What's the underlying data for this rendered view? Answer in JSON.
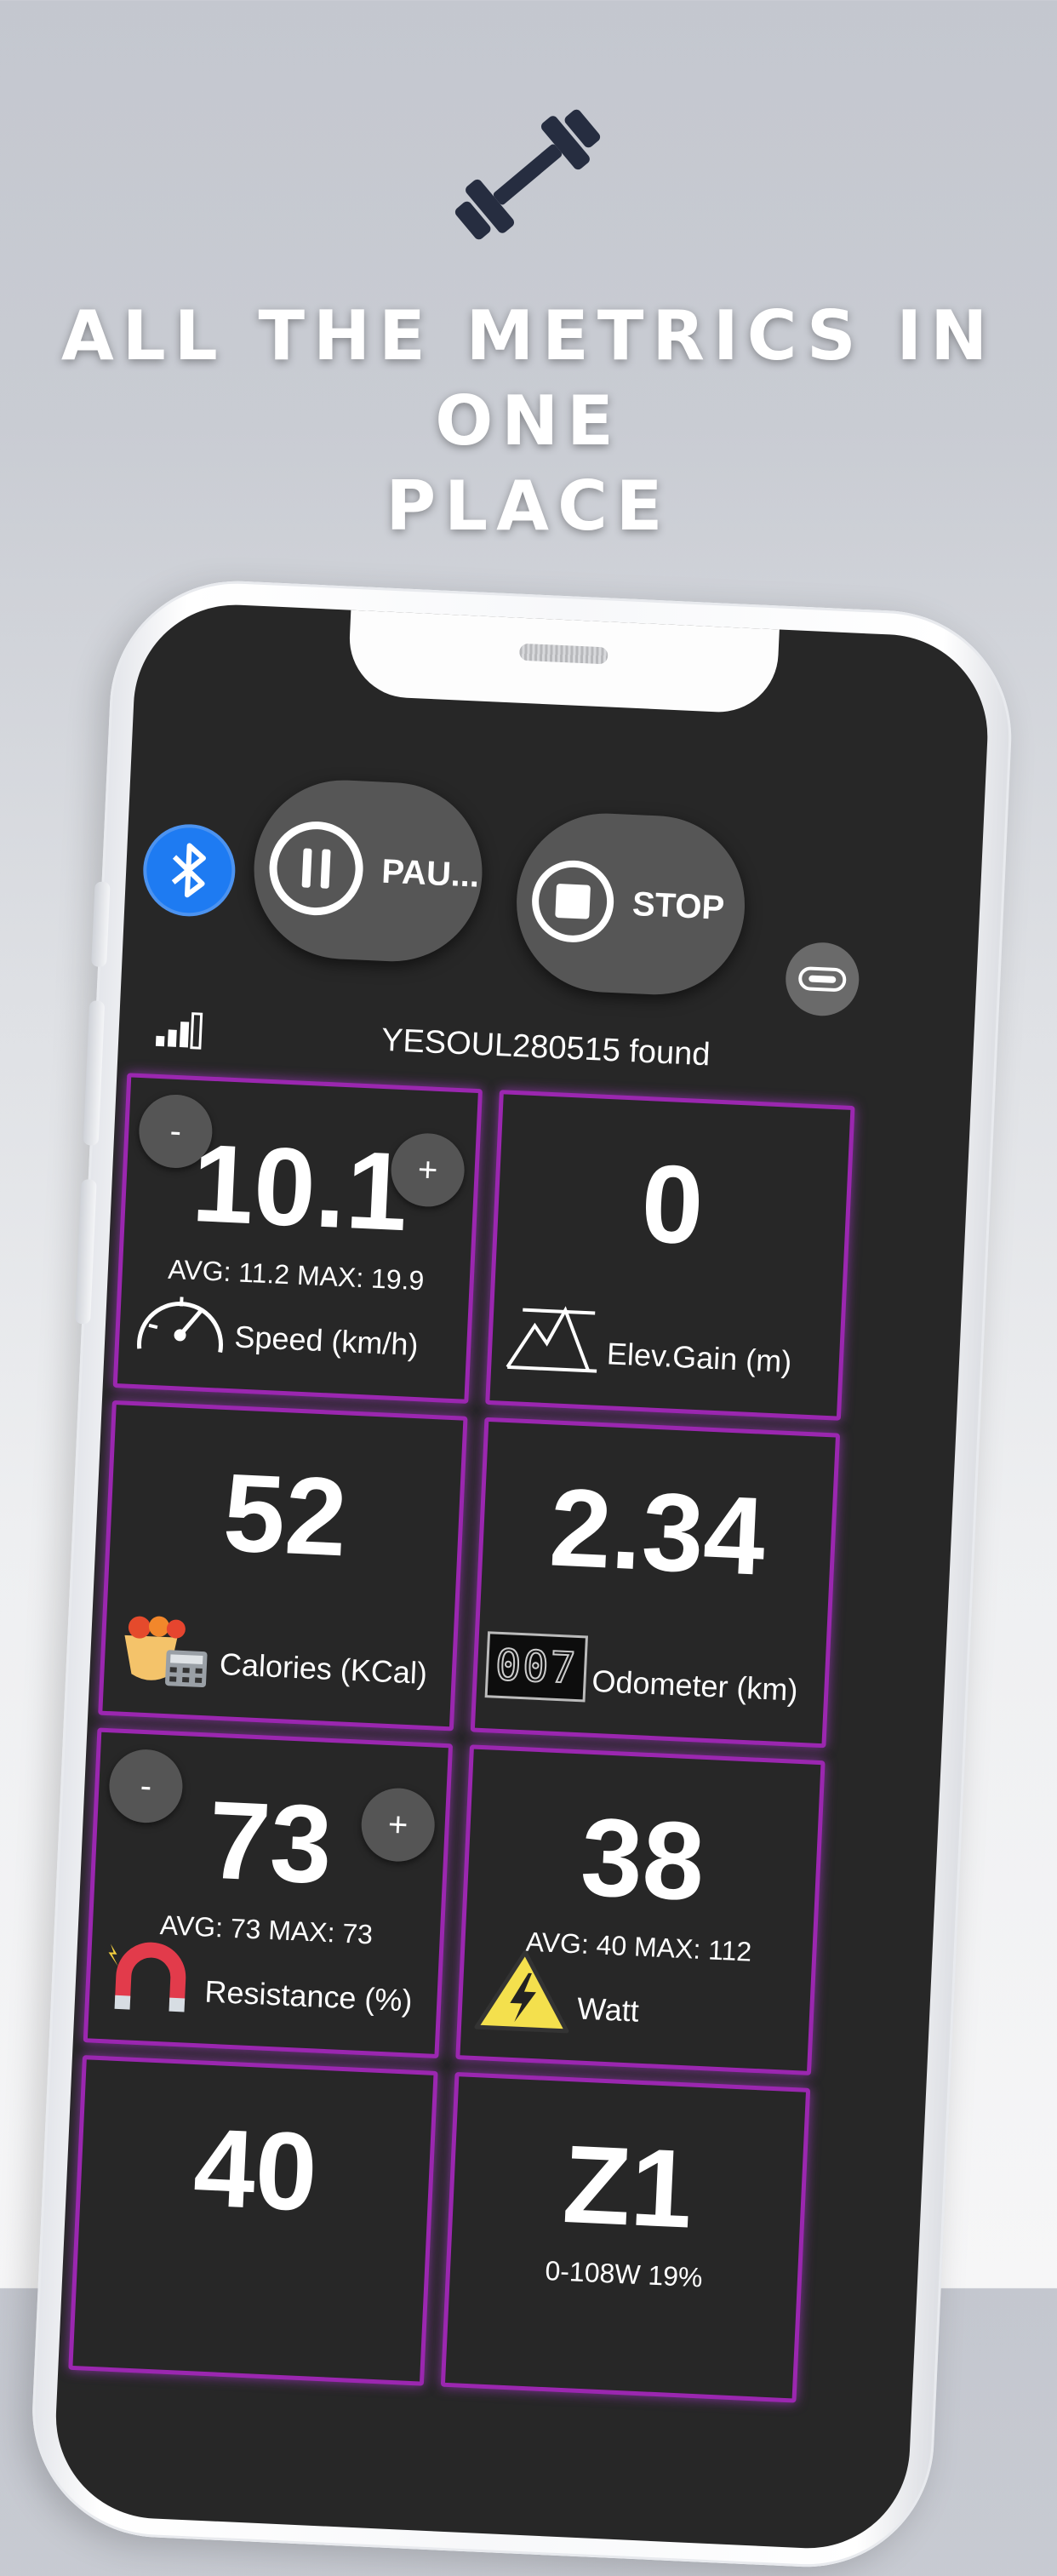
{
  "headline": {
    "line1": "ALL THE METRICS IN ONE",
    "line2": "PLACE"
  },
  "icons": {
    "hero": "dumbbell-icon",
    "bluetooth": "bluetooth-icon",
    "pause": "pause-icon",
    "stop": "stop-icon",
    "treadmill": "treadmill-icon"
  },
  "toolbar": {
    "pause_label": "PAU...",
    "stop_label": "STOP"
  },
  "status": {
    "device_found": "YESOUL280515 found"
  },
  "tiles": {
    "speed": {
      "value": "10.1",
      "stats": "AVG: 11.2 MAX: 19.9",
      "label": "Speed (km/h)",
      "minus": "-",
      "plus": "+"
    },
    "elev": {
      "value": "0",
      "label": "Elev.Gain (m)"
    },
    "calories": {
      "value": "52",
      "label": "Calories (KCal)"
    },
    "odometer": {
      "value": "2.34",
      "label": "Odometer (km)",
      "digits": "007"
    },
    "resistance": {
      "value": "73",
      "stats": "AVG: 73 MAX: 73",
      "label": "Resistance (%)",
      "minus": "-",
      "plus": "+"
    },
    "watt": {
      "value": "38",
      "stats": "AVG: 40 MAX: 112",
      "label": "Watt"
    },
    "cadence": {
      "value": "40"
    },
    "zone": {
      "value": "Z1",
      "stats": "0-108W 19%"
    }
  },
  "colors": {
    "accent_border": "#9b27b0",
    "bluetooth": "#1e7bf2",
    "screen_bg": "#272727"
  }
}
